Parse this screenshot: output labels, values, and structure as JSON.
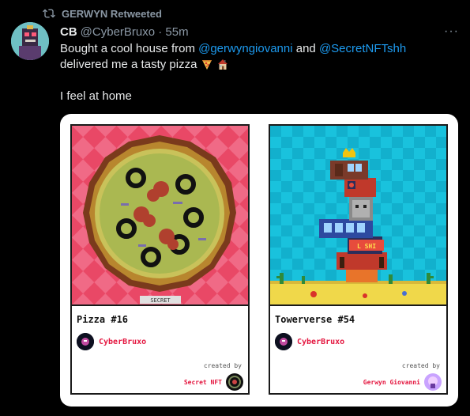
{
  "retweet": {
    "label": "GERWYN Retweeted"
  },
  "tweet": {
    "name": "CB",
    "handle": "@CyberBruxo · 55m",
    "text_pre": "Bought a cool house from ",
    "mention1": "@gerwyngiovanni",
    "text_mid": " and ",
    "mention2": "@SecretNFTshh",
    "text_post": " delivered me a tasty pizza",
    "line2": "I feel at home",
    "more_label": "···"
  },
  "cards": [
    {
      "title": "Pizza #16",
      "owner": "CyberBruxo",
      "created_label": "created by",
      "creator": "Secret NFT",
      "art_caption": "SECRET"
    },
    {
      "title": "Towerverse #54",
      "owner": "CyberBruxo",
      "created_label": "created by",
      "creator": "Gerwyn Giovanni",
      "art_sign": "L SHI"
    }
  ],
  "colors": {
    "background": "#000000",
    "text": "#e7e9ea",
    "muted": "#8b98a5",
    "mention": "#1d9bf0",
    "card_red": "#e4163f"
  },
  "icons": [
    "retweet-icon",
    "more-icon",
    "pizza-emoji-icon",
    "house-emoji-icon"
  ]
}
